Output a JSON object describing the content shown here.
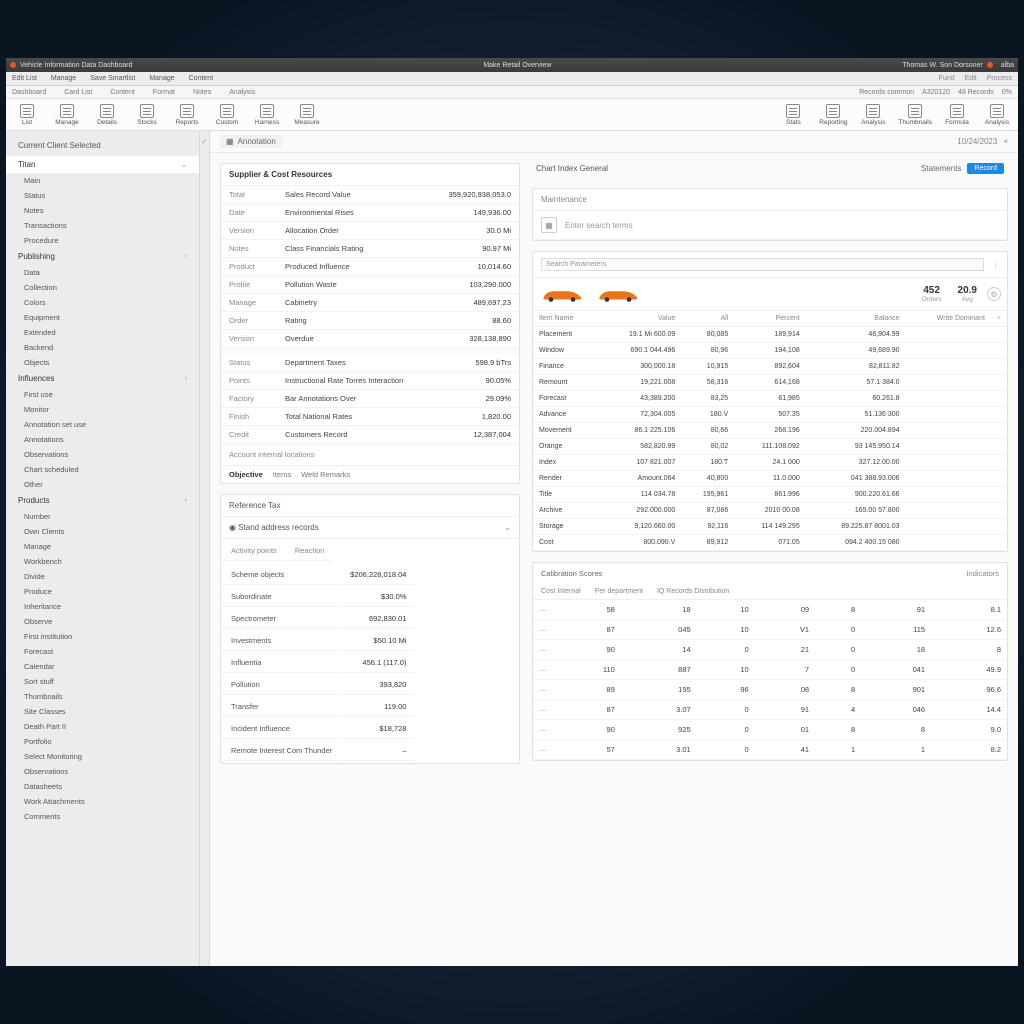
{
  "titlebar": {
    "left": "Vehicle Information Data Dashboard",
    "center": "Make Retail Overview",
    "right_a": "Thomas W. Son Dorsoner",
    "right_b": "alba"
  },
  "menubar": {
    "items": [
      "Edit List",
      "Manage",
      "Save Smartlist",
      "Manage",
      "Content"
    ],
    "right": [
      "Fund",
      "Edit",
      "Process"
    ]
  },
  "subbar": {
    "items": [
      "Dashboard",
      "Card List",
      "Content",
      "Format",
      "Notes",
      "Analysis"
    ],
    "right": [
      "Records common",
      "A320120",
      "48 Records",
      "0%"
    ]
  },
  "ribbon": {
    "left": [
      "List",
      "Manage",
      "Details",
      "Stocks",
      "Reports",
      "Custom",
      "Harness",
      "Measure"
    ],
    "right": [
      "Stats",
      "Reporting",
      "Analysis",
      "Thumbnails",
      "Formula",
      "Analysis"
    ]
  },
  "sidebar": {
    "title": "Current Client Selected",
    "sections": [
      {
        "label": "Titan",
        "items": [
          "Main",
          "Status",
          "Notes",
          "Transactions",
          "Procedure"
        ],
        "open": true
      },
      {
        "label": "Publishing",
        "items": [
          "Data",
          "Collection",
          "Colors",
          "Equipment",
          "Extended",
          "Backend",
          "Objects"
        ]
      },
      {
        "label": "Influences",
        "items": [
          "First use",
          "Monitor",
          "Annotation set use",
          "Annotations",
          "Observations",
          "Chart scheduled",
          "Other"
        ]
      },
      {
        "label": "Products",
        "items": [
          "Number",
          "Own Clients",
          "Manage",
          "Workbench",
          "Divide",
          "Produce",
          "Inheritance",
          "Observe",
          "First institution",
          "Forecast",
          "Calendar",
          "Sort stuff",
          "Thumbnails",
          "Site Classes",
          "Death Part II",
          "Portfolio",
          "Select Monitoring",
          "Observations",
          "Datasheets",
          "Work Attachments",
          "Comments"
        ]
      }
    ]
  },
  "crumb": {
    "icon": "▦",
    "label": "Annotation",
    "date": "10/24/2023",
    "close": "×"
  },
  "panel1": {
    "title": "Supplier & Cost Resources",
    "rows": [
      [
        "Total",
        "Sales Record Value",
        "359,920,938,053.0"
      ],
      [
        "Date",
        "Environmental Rises",
        "149,936.00"
      ],
      [
        "Version",
        "Allocation Order",
        "30.0 Mi"
      ],
      [
        "Notes",
        "Class Financials Rating",
        "90.97 Mi"
      ],
      [
        "Product",
        "Produced Influence",
        "10,014.60"
      ],
      [
        "Profile",
        "Pollution Waste",
        "103,290.000"
      ],
      [
        "Manage",
        "Cabinetry",
        "489,697.23"
      ],
      [
        "Order",
        "Rating",
        "88.60"
      ],
      [
        "Version",
        "Overdue",
        "328,138,890"
      ]
    ],
    "rows2": [
      [
        "Status",
        "Department Taxes",
        "598.9 bTrs"
      ],
      [
        "Points",
        "Instructional Rate Torres Interaction",
        "90.05%"
      ],
      [
        "Factory",
        "Bar Annotations Over",
        "29.09%"
      ],
      [
        "Finish",
        "Total National Rates",
        "1,820.00"
      ],
      [
        "Credit",
        "Customers Record",
        "12,387,004"
      ]
    ],
    "rows2_label": "Account internal locations",
    "tabs": [
      "Objective",
      "Items",
      "Weld Remarks"
    ]
  },
  "panel2": {
    "title": "Reference Tax",
    "toggle": "◉ Stand address records",
    "header": [
      "Activity points",
      "Reaction"
    ],
    "rows": [
      [
        "Scheme objects",
        "$206,228,018.04"
      ],
      [
        "Subordinate",
        "$30.0%"
      ],
      [
        "Spectrometer",
        "692,830.01"
      ],
      [
        "Investments",
        "$50.10 Mi"
      ],
      [
        "Influentia",
        "456.1 (117.0)"
      ],
      [
        "Pollution",
        "393,820"
      ],
      [
        "Transfer",
        "119.00"
      ],
      [
        "Incident Influence",
        "$18,728"
      ],
      [
        "Remote Interest Com Thunder",
        "–"
      ]
    ]
  },
  "right_header": {
    "title": "Chart Index General",
    "link": "Statements",
    "btn": "Record"
  },
  "vehicle_filter": {
    "label": "Maintenance",
    "icon_label": "▦",
    "search": "Enter search terms"
  },
  "vehicle_card": {
    "search_label": "Search Parameters",
    "stats": [
      {
        "n": "452",
        "l": "Orders"
      },
      {
        "n": "20.9",
        "l": "Avg"
      }
    ],
    "cols": [
      "Item Name",
      "Value",
      "All",
      "Percent",
      "Balance",
      "Write Dominant"
    ],
    "rows": [
      [
        "Placement",
        "19.1 Mi 600.09",
        "80,085",
        "189,914",
        "46,904.99",
        ""
      ],
      [
        "Window",
        "690.1 044.496",
        "80,96",
        "194,108",
        "49,689.90",
        ""
      ],
      [
        "Finance",
        "300,000.18",
        "10,915",
        "892,604",
        "82,811.82",
        ""
      ],
      [
        "Remount",
        "19,221.008",
        "58,316",
        "614,168",
        "57.1 384.0",
        ""
      ],
      [
        "Forecast",
        "43,389.200",
        "83,25",
        "61,985",
        "60.261.8",
        ""
      ],
      [
        "Advance",
        "72,304.005",
        "180.V",
        "507.35",
        "51.136 300",
        ""
      ],
      [
        "Movement",
        "86.1 225.106",
        "80,66",
        "268.196",
        "220.004.894",
        ""
      ],
      [
        "Orange",
        "582,820.99",
        "80,02",
        "111.108.092",
        "93 145.950.14",
        ""
      ],
      [
        "Index",
        "107 821.007",
        "180.T",
        "24.1 000",
        "327.12.00.00",
        ""
      ],
      [
        "Render",
        "Amount.064",
        "40,800",
        "11.0.000",
        "041 388.93.006",
        ""
      ],
      [
        "Title",
        "114 034.78",
        "195,961",
        "861.996",
        "900.220.61.66",
        ""
      ],
      [
        "Archive",
        "292.000.000",
        "87,086",
        "2010 00.08",
        "165.00 57.800",
        ""
      ],
      [
        "Storage",
        "9,120.660.00",
        "92,116",
        "114 149.295",
        "89.225.87 8001.03",
        ""
      ],
      [
        "Cost",
        "800.090.V",
        "89,912",
        "071.05",
        "094.2 400.15 080",
        ""
      ]
    ]
  },
  "lower": {
    "left": "Calibration Scores",
    "right": "Indicators",
    "cols": [
      "Cost Internal",
      "Per department",
      "IQ Records Distribution"
    ],
    "rows": [
      [
        "—",
        "58",
        "18",
        "10",
        "09",
        "8",
        "91",
        "8.1"
      ],
      [
        "—",
        "87",
        "045",
        "10",
        "V1",
        "0",
        "115",
        "12.6"
      ],
      [
        "—",
        "90",
        "14",
        "0",
        "21",
        "0",
        "18",
        "8"
      ],
      [
        "—",
        "110",
        "887",
        "10",
        "7",
        "0",
        "041",
        "49.9"
      ],
      [
        "—",
        "89",
        "195",
        "96",
        "08",
        "8",
        "901",
        "96.6"
      ],
      [
        "—",
        "87",
        "3.07",
        "0",
        "91",
        "4",
        "046",
        "14.4"
      ],
      [
        "—",
        "90",
        "925",
        "0",
        "01",
        "8",
        "8",
        "9.0"
      ],
      [
        "—",
        "57",
        "3.01",
        "0",
        "41",
        "1",
        "1",
        "8.2"
      ]
    ]
  }
}
